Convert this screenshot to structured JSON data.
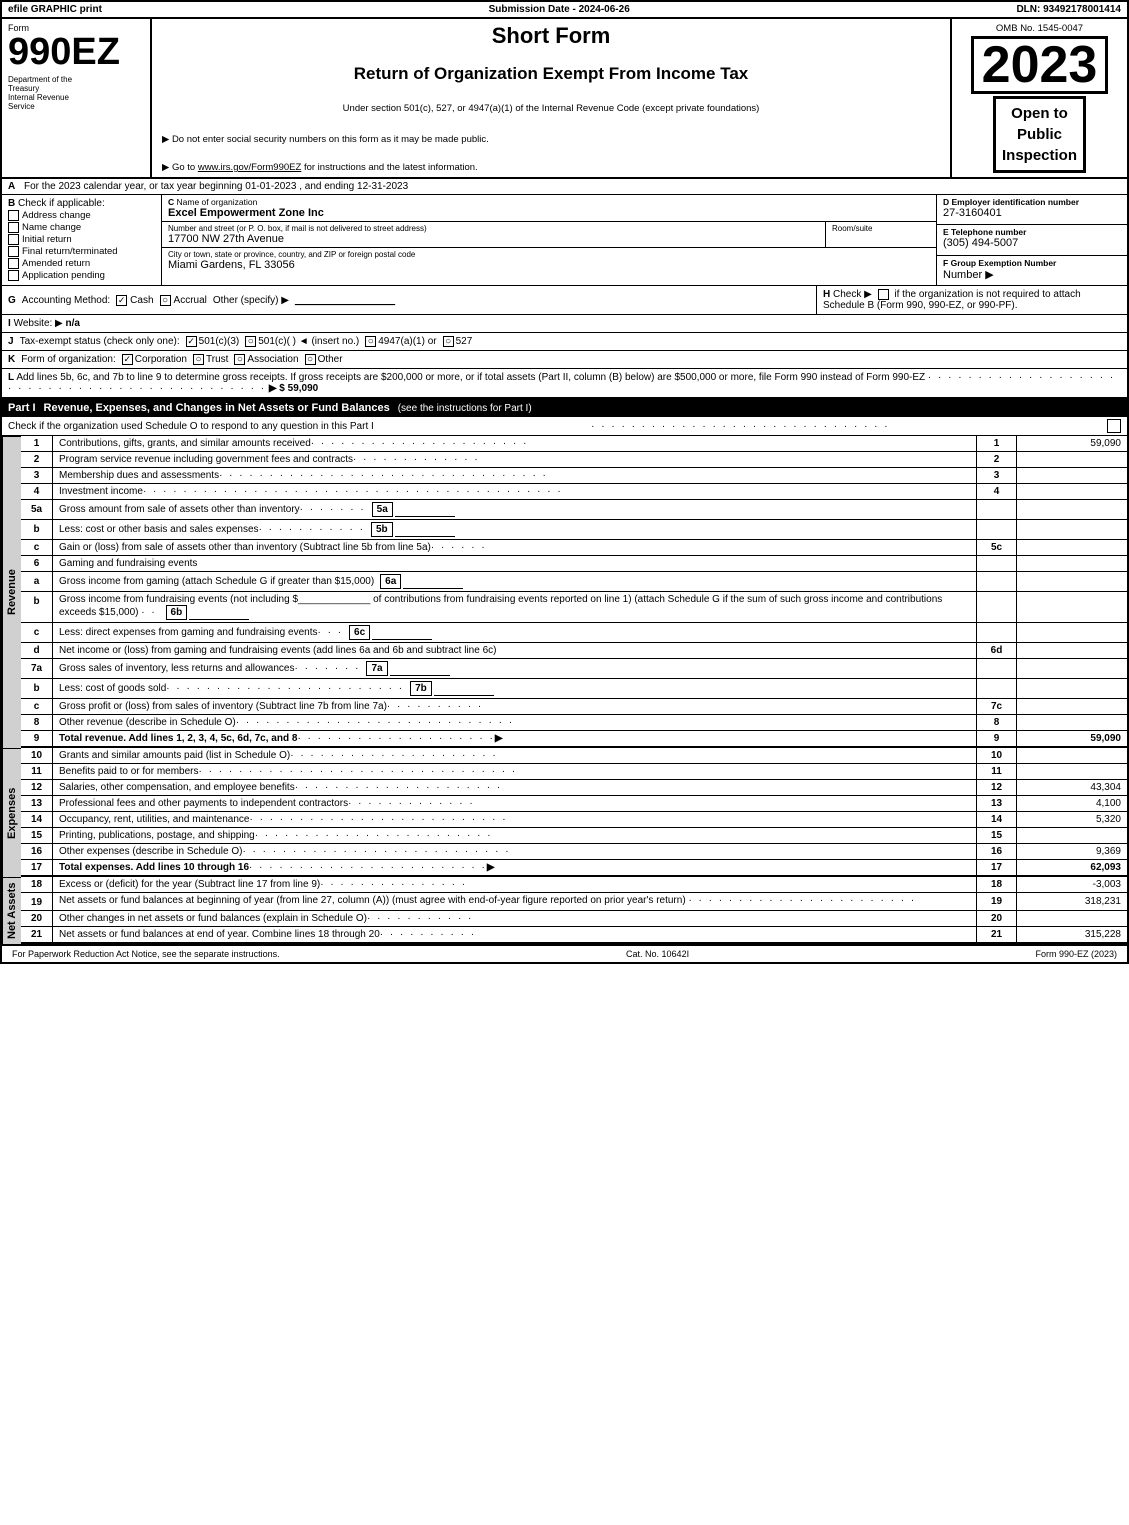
{
  "header_bar": {
    "left": "efile GRAPHIC print",
    "center": "Submission Date - 2024-06-26",
    "right": "DLN: 93492178001414"
  },
  "form": {
    "number": "990EZ",
    "dept_line1": "Department of the",
    "dept_line2": "Treasury",
    "dept_line3": "Internal Revenue",
    "dept_line4": "Service",
    "title_main": "Short Form",
    "title_sub": "Return of Organization Exempt From Income Tax",
    "instruction1": "Under section 501(c), 527, or 4947(a)(1) of the Internal Revenue Code (except private foundations)",
    "instruction2": "▶ Do not enter social security numbers on this form as it may be made public.",
    "instruction3": "▶ Go to www.irs.gov/Form990EZ for instructions and the latest information.",
    "omb": "OMB No. 1545-0047",
    "year": "2023",
    "open_to_public": "Open to\nPublic\nInspection"
  },
  "section_a": {
    "label": "A",
    "text": "For the 2023 calendar year, or tax year beginning 01-01-2023 , and ending 12-31-2023"
  },
  "section_b": {
    "label": "B",
    "check_label": "Check if applicable:",
    "items": [
      {
        "label": "Address change",
        "checked": false
      },
      {
        "label": "Name change",
        "checked": false
      },
      {
        "label": "Initial return",
        "checked": false
      },
      {
        "label": "Final return/terminated",
        "checked": false
      },
      {
        "label": "Amended return",
        "checked": false
      },
      {
        "label": "Application pending",
        "checked": false
      }
    ]
  },
  "section_c": {
    "label": "C",
    "name_label": "Name of organization",
    "org_name": "Excel Empowerment Zone Inc",
    "address_label": "Number and street (or P. O. box, if mail is not delivered to street address)",
    "address": "17700 NW 27th Avenue",
    "room_label": "Room/suite",
    "room": "",
    "city_label": "City or town, state or province, country, and ZIP or foreign postal code",
    "city": "Miami Gardens, FL  33056"
  },
  "section_d": {
    "label": "D",
    "ein_label": "Employer identification number",
    "ein": "27-3160401"
  },
  "section_e": {
    "label": "E",
    "phone_label": "Telephone number",
    "phone": "(305) 494-5007"
  },
  "section_f": {
    "label": "F",
    "group_label": "Group Exemption Number",
    "arrow": "▶"
  },
  "accounting": {
    "label": "G",
    "text": "Accounting Method:",
    "cash_label": "Cash",
    "cash_checked": true,
    "accrual_label": "Accrual",
    "accrual_checked": false,
    "other_label": "Other (specify) ▶",
    "other_line": "___________________",
    "h_label": "H",
    "h_text": "Check ▶",
    "h_check": false,
    "h_desc": "if the organization is not required to attach Schedule B (Form 990, 990-EZ, or 990-PF)."
  },
  "website": {
    "label": "I",
    "text": "Website: ▶",
    "url": "n/a"
  },
  "tax_status": {
    "label": "J",
    "text": "Tax-exempt status (check only one):",
    "options": [
      {
        "label": "501(c)(3)",
        "checked": true
      },
      {
        "label": "501(c)(  ) ◄ (insert no.)",
        "checked": false
      },
      {
        "label": "4947(a)(1) or",
        "checked": false
      },
      {
        "label": "527",
        "checked": false
      }
    ]
  },
  "k_form": {
    "label": "K",
    "text": "Form of organization:",
    "options": [
      {
        "label": "Corporation",
        "checked": true
      },
      {
        "label": "Trust",
        "checked": false
      },
      {
        "label": "Association",
        "checked": false
      },
      {
        "label": "Other",
        "checked": false
      }
    ]
  },
  "l_add": {
    "label": "L",
    "text": "Add lines 5b, 6c, and 7b to line 9 to determine gross receipts. If gross receipts are $200,000 or more, or if total assets (Part II, column (B) below) are $500,000 or more, file Form 990 instead of Form 990-EZ",
    "dots": "· · · · · · · · · · · · · · · · · · · · · · · · · · · · · · · · · · · · · · · · · ·",
    "arrow": "▶ $",
    "value": "59,090"
  },
  "part1": {
    "label": "Part I",
    "title": "Revenue, Expenses, and Changes in Net Assets or Fund Balances",
    "instructions": "(see the instructions for Part I)",
    "check_text": "Check if the organization used Schedule O to respond to any question in this Part I",
    "dots": "· · · · · · · · · · · · · · · · · · · · · · · · · · · · ·",
    "rows": [
      {
        "num": "1",
        "desc": "Contributions, gifts, grants, and similar amounts received · · · · · · · · · · · · · · · · · · · ·",
        "code": "1",
        "value": "59,090"
      },
      {
        "num": "2",
        "desc": "Program service revenue including government fees and contracts · · · · · · · · · · · · · ·",
        "code": "2",
        "value": ""
      },
      {
        "num": "3",
        "desc": "Membership dues and assessments · · · · · · · · · · · · · · · · · · · · · · · · · · · · · · · · ·",
        "code": "3",
        "value": ""
      },
      {
        "num": "4",
        "desc": "Investment income · · · · · · · · · · · · · · · · · · · · · · · · · · · · · · · · · · · · · · · · · ·",
        "code": "4",
        "value": ""
      },
      {
        "num": "5a",
        "desc": "Gross amount from sale of assets other than inventory · · · · · · ·",
        "code": "5a",
        "value": "",
        "inline": true
      },
      {
        "num": "b",
        "desc": "Less: cost or other basis and sales expenses · · · · · · · · · · ·",
        "code": "5b",
        "value": "",
        "inline": true
      },
      {
        "num": "c",
        "desc": "Gain or (loss) from sale of assets other than inventory (Subtract line 5b from line 5a) · · · · · ·",
        "code": "5c",
        "value": ""
      },
      {
        "num": "6",
        "desc": "Gaming and fundraising events",
        "code": "",
        "value": "",
        "no_value": true
      },
      {
        "num": "a",
        "desc": "Gross income from gaming (attach Schedule G if greater than $15,000)",
        "code": "6a",
        "value": "",
        "inline": true
      },
      {
        "num": "b",
        "desc": "Gross income from fundraising events (not including $_____________ of contributions from fundraising events reported on line 1) (attach Schedule G if the sum of such gross income and contributions exceeds $15,000) · ·",
        "code": "6b",
        "value": "",
        "inline": true
      },
      {
        "num": "c",
        "desc": "Less: direct expenses from gaming and fundraising events · · ·",
        "code": "6c",
        "value": "",
        "inline": true
      },
      {
        "num": "d",
        "desc": "Net income or (loss) from gaming and fundraising events (add lines 6a and 6b and subtract line 6c)",
        "code": "6d",
        "value": ""
      },
      {
        "num": "7a",
        "desc": "Gross sales of inventory, less returns and allowances · · · · · · ·",
        "code": "7a",
        "value": "",
        "inline": true
      },
      {
        "num": "b",
        "desc": "Less: cost of goods sold · · · · · · · · · · · · · · · · · · · · ·",
        "code": "7b",
        "value": "",
        "inline": true
      },
      {
        "num": "c",
        "desc": "Gross profit or (loss) from sales of inventory (Subtract line 7b from line 7a) · · · · · · · · · ·",
        "code": "7c",
        "value": ""
      },
      {
        "num": "8",
        "desc": "Other revenue (describe in Schedule O) · · · · · · · · · · · · · · · · · · · · · · · · · · · · ·",
        "code": "8",
        "value": ""
      },
      {
        "num": "9",
        "desc": "Total revenue. Add lines 1, 2, 3, 4, 5c, 6d, 7c, and 8 · · · · · · · · · · · · · · · · · · · · ▶",
        "code": "9",
        "value": "59,090",
        "bold": true
      }
    ]
  },
  "expenses_rows": [
    {
      "num": "10",
      "desc": "Grants and similar amounts paid (list in Schedule O) · · · · · · · · · · · · · · · · · · · · · ·",
      "code": "10",
      "value": ""
    },
    {
      "num": "11",
      "desc": "Benefits paid to or for members · · · · · · · · · · · · · · · · · · · · · · · · · · · · · · · · ·",
      "code": "11",
      "value": ""
    },
    {
      "num": "12",
      "desc": "Salaries, other compensation, and employee benefits · · · · · · · · · · · · · · · · · · · · · ·",
      "code": "12",
      "value": "43,304"
    },
    {
      "num": "13",
      "desc": "Professional fees and other payments to independent contractors · · · · · · · · · · · · · · ·",
      "code": "13",
      "value": "4,100"
    },
    {
      "num": "14",
      "desc": "Occupancy, rent, utilities, and maintenance · · · · · · · · · · · · · · · · · · · · · · · · · · ·",
      "code": "14",
      "value": "5,320"
    },
    {
      "num": "15",
      "desc": "Printing, publications, postage, and shipping · · · · · · · · · · · · · · · · · · · · · · · · · ·",
      "code": "15",
      "value": ""
    },
    {
      "num": "16",
      "desc": "Other expenses (describe in Schedule O) · · · · · · · · · · · · · · · · · · · · · · · · · · · ·",
      "code": "16",
      "value": "9,369"
    },
    {
      "num": "17",
      "desc": "Total expenses. Add lines 10 through 16 · · · · · · · · · · · · · · · · · · · · · · · · · · · ▶",
      "code": "17",
      "value": "62,093",
      "bold": true
    }
  ],
  "net_assets_rows": [
    {
      "num": "18",
      "desc": "Excess or (deficit) for the year (Subtract line 17 from line 9) · · · · · · · · · · · · · · · · ·",
      "code": "18",
      "value": "-3,003"
    },
    {
      "num": "19",
      "desc": "Net assets or fund balances at beginning of year (from line 27, column (A)) (must agree with end-of-year figure reported on prior year's return) · · · · · · · · · · · · · · · · · · · · · · · ·",
      "code": "19",
      "value": "318,231"
    },
    {
      "num": "20",
      "desc": "Other changes in net assets or fund balances (explain in Schedule O) · · · · · · · · · · · ·",
      "code": "20",
      "value": ""
    },
    {
      "num": "21",
      "desc": "Net assets or fund balances at end of year. Combine lines 18 through 20 · · · · · · · · · · ·",
      "code": "21",
      "value": "315,228"
    }
  ],
  "footer": {
    "left": "For Paperwork Reduction Act Notice, see the separate instructions.",
    "center": "Cat. No. 10642I",
    "right": "Form 990-EZ (2023)"
  }
}
